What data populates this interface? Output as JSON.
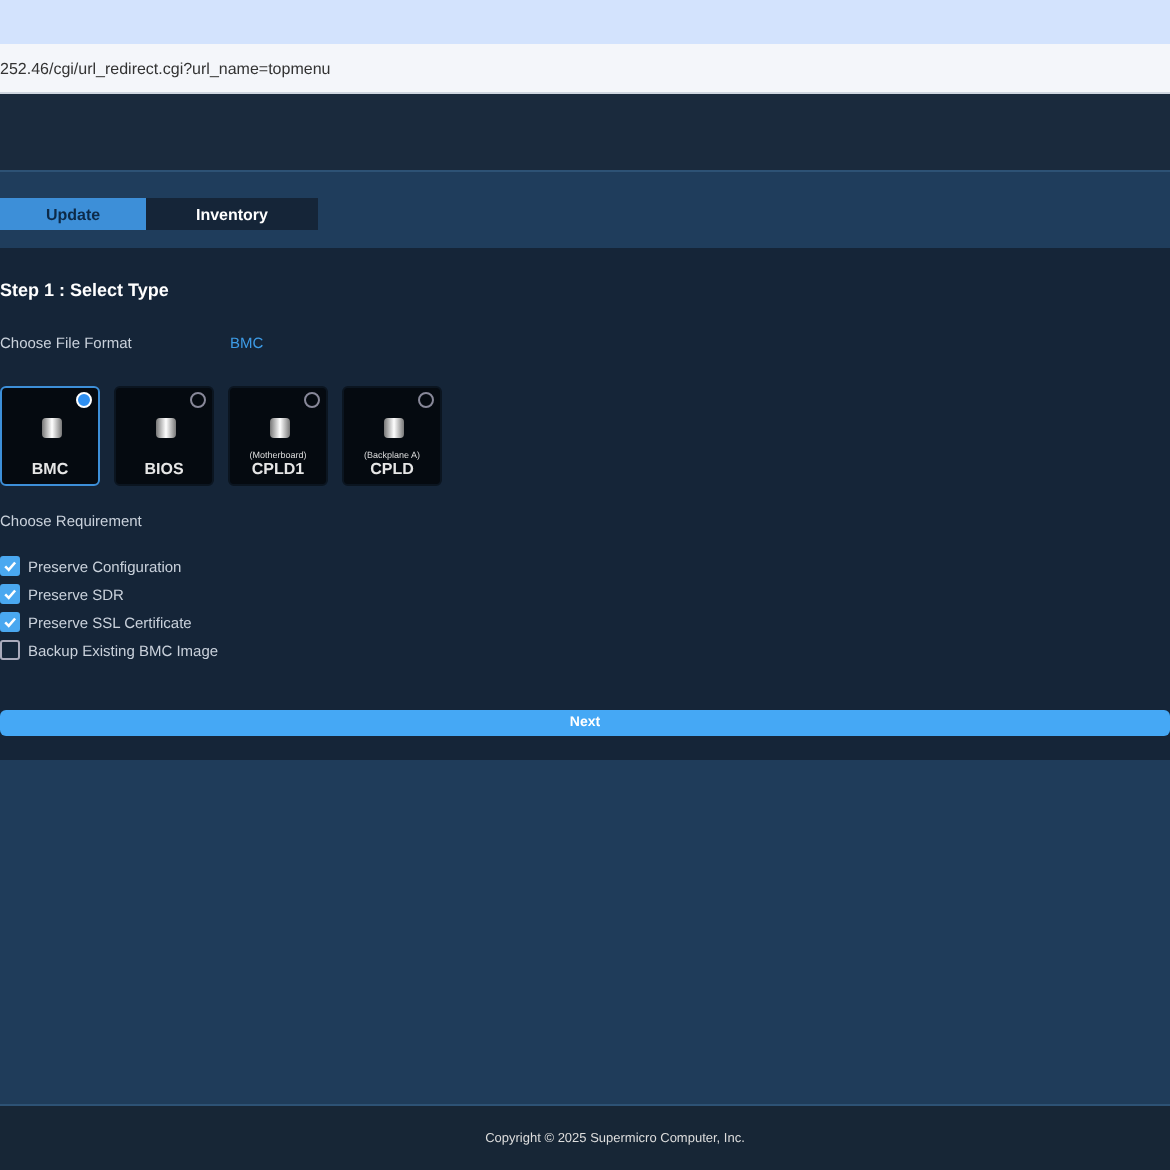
{
  "address_bar": {
    "url": "252.46/cgi/url_redirect.cgi?url_name=topmenu"
  },
  "tabs": [
    {
      "label": "Update",
      "selected": true
    },
    {
      "label": "Inventory",
      "selected": false
    }
  ],
  "step_title": "Step 1 : Select Type",
  "file_format": {
    "label": "Choose File Format",
    "value": "BMC"
  },
  "types": [
    {
      "label": "BMC",
      "selected": true
    },
    {
      "label": "BIOS",
      "selected": false
    },
    {
      "caption": "(Motherboard)",
      "label": "CPLD1",
      "selected": false
    },
    {
      "caption": "(Backplane A)",
      "label": "CPLD",
      "selected": false
    }
  ],
  "requirement_label": "Choose Requirement",
  "requirements": [
    {
      "label": "Preserve Configuration",
      "checked": true
    },
    {
      "label": "Preserve SDR",
      "checked": true
    },
    {
      "label": "Preserve SSL Certificate",
      "checked": true
    },
    {
      "label": "Backup Existing BMC Image",
      "checked": false
    }
  ],
  "next_button": "Next",
  "footer": "Copyright © 2025 Supermicro Computer, Inc."
}
